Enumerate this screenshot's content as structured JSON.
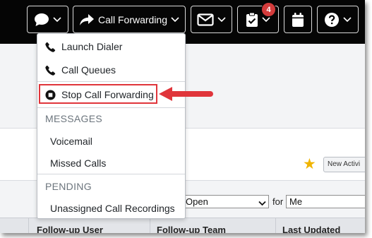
{
  "navbar": {
    "call_forwarding_label": "Call Forwarding",
    "tasks_badge_count": "4",
    "buttons": [
      {
        "name": "chat",
        "icon": "chat-bubble-icon"
      },
      {
        "name": "call-forwarding",
        "icon": "forward-arrow-icon"
      },
      {
        "name": "mail",
        "icon": "envelope-icon"
      },
      {
        "name": "tasks",
        "icon": "clipboard-check-icon"
      },
      {
        "name": "calendar",
        "icon": "calendar-icon"
      },
      {
        "name": "help",
        "icon": "question-circle-icon"
      }
    ]
  },
  "dropdown": {
    "launch_dialer": "Launch Dialer",
    "call_queues": "Call Queues",
    "stop_call_forwarding": "Stop Call Forwarding",
    "messages_header": "MESSAGES",
    "voicemail": "Voicemail",
    "missed_calls": "Missed Calls",
    "pending_header": "PENDING",
    "unassigned_recordings": "Unassigned Call Recordings"
  },
  "page": {
    "new_activity_label": "New Activi",
    "status_select_value": "Open",
    "for_label": "for",
    "owner_input_value": "Me",
    "table_headers": [
      "Follow-up User",
      "Follow-up Team",
      "Last Updated"
    ]
  },
  "colors": {
    "navbar_bg": "#050505",
    "annotation_red": "#e0353b",
    "star": "#f0b400",
    "badge": "#d33b3b"
  }
}
